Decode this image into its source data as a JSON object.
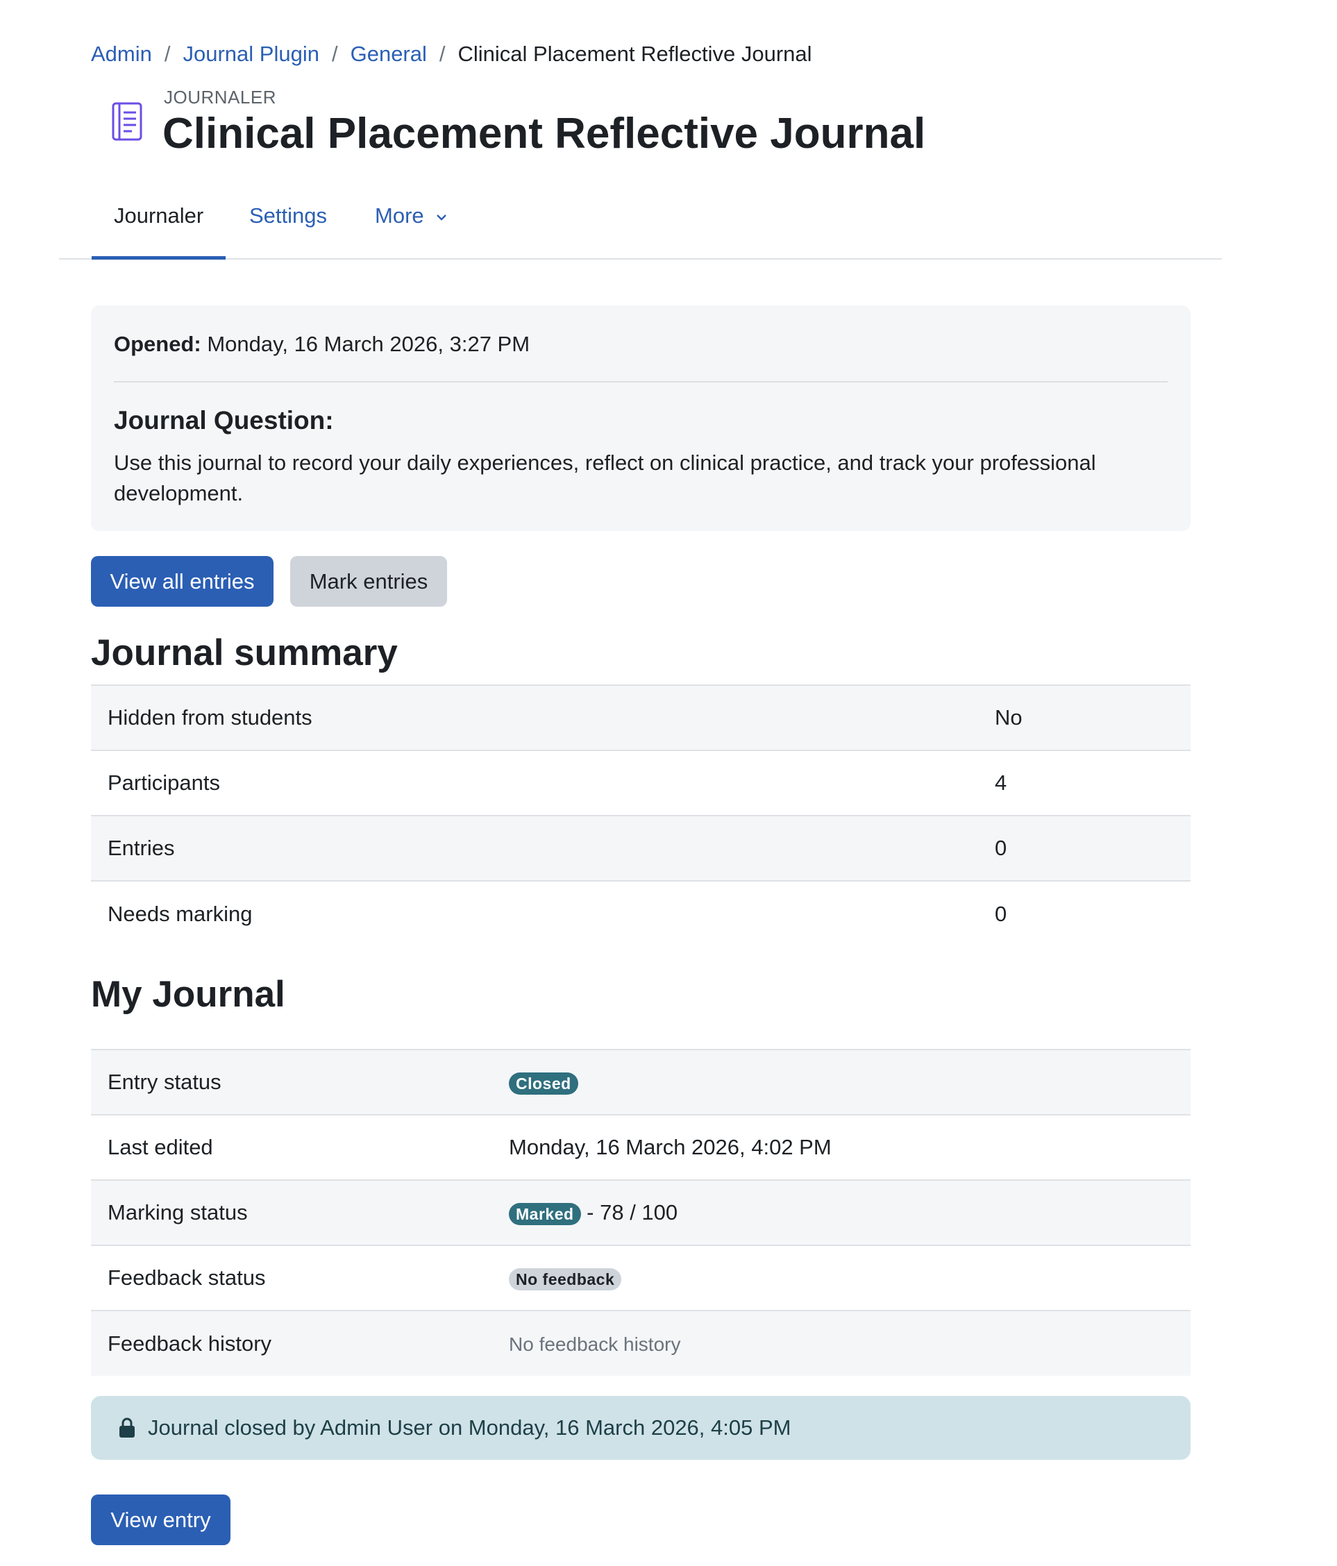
{
  "breadcrumb": {
    "items": [
      "Admin",
      "Journal Plugin",
      "General"
    ],
    "current": "Clinical Placement Reflective Journal",
    "separator": "/"
  },
  "header": {
    "kind": "JOURNALER",
    "title": "Clinical Placement Reflective Journal",
    "icon": "journal-icon"
  },
  "tabs": {
    "journaler": "Journaler",
    "settings": "Settings",
    "more": "More"
  },
  "intro": {
    "opened_label": "Opened:",
    "opened_value": "Monday, 16 March 2026, 3:27 PM",
    "question_title": "Journal Question:",
    "question_text": "Use this journal to record your daily experiences, reflect on clinical practice, and track your professional development."
  },
  "actions": {
    "view_all": "View all entries",
    "mark": "Mark entries"
  },
  "summary": {
    "title": "Journal summary",
    "rows": [
      {
        "label": "Hidden from students",
        "value": "No"
      },
      {
        "label": "Participants",
        "value": "4"
      },
      {
        "label": "Entries",
        "value": "0"
      },
      {
        "label": "Needs marking",
        "value": "0"
      }
    ]
  },
  "my_journal": {
    "title": "My Journal",
    "entry_status_label": "Entry status",
    "entry_status_badge": "Closed",
    "last_edited_label": "Last edited",
    "last_edited_value": "Monday, 16 March 2026, 4:02 PM",
    "marking_status_label": "Marking status",
    "marking_status_badge": "Marked",
    "marking_score": "- 78 / 100",
    "feedback_status_label": "Feedback status",
    "feedback_status_badge": "No feedback",
    "feedback_history_label": "Feedback history",
    "feedback_history_value": "No feedback history"
  },
  "alert": {
    "icon": "lock-icon",
    "text": "Journal closed by Admin User on Monday, 16 March 2026, 4:05 PM"
  },
  "footer_actions": {
    "view_entry": "View entry"
  },
  "colors": {
    "primary": "#2b5fb4",
    "badge_teal": "#2f6f7e",
    "badge_grey": "#ced4da",
    "alert_bg": "#cfe2e7",
    "icon_purple": "#6b4ee6"
  }
}
